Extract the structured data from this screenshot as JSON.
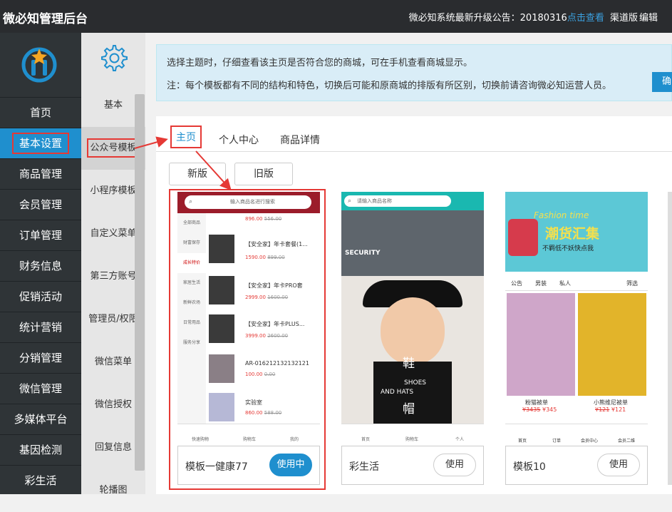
{
  "header": {
    "title": "微必知管理后台",
    "notice_prefix": "微必知系统最新升级公告：20180316",
    "notice_link": "点击查看",
    "channel": "渠道版",
    "edit": "编辑"
  },
  "sidebar": {
    "items": [
      {
        "label": "首页"
      },
      {
        "label": "基本设置"
      },
      {
        "label": "商品管理"
      },
      {
        "label": "会员管理"
      },
      {
        "label": "订单管理"
      },
      {
        "label": "财务信息"
      },
      {
        "label": "促销活动"
      },
      {
        "label": "统计营销"
      },
      {
        "label": "分销管理"
      },
      {
        "label": "微信管理"
      },
      {
        "label": "多媒体平台"
      },
      {
        "label": "基因检测"
      },
      {
        "label": "彩生活"
      }
    ]
  },
  "subnav": {
    "items": [
      {
        "label": "基本"
      },
      {
        "label": "公众号模板"
      },
      {
        "label": "小程序模板"
      },
      {
        "label": "自定义菜单"
      },
      {
        "label": "第三方账号"
      },
      {
        "label": "管理员/权限"
      },
      {
        "label": "微信菜单"
      },
      {
        "label": "微信授权"
      },
      {
        "label": "回复信息"
      },
      {
        "label": "轮播图"
      }
    ]
  },
  "tip": {
    "line1": "选择主题时，仔细查看该主页是否符合您的商城，可在手机查看商城显示。",
    "line2": "注：每个模板都有不同的结构和特色，切换后可能和原商城的排版有所区别，切换前请咨询微必知运营人员。",
    "button": "确"
  },
  "tabs": [
    {
      "label": "主页"
    },
    {
      "label": "个人中心"
    },
    {
      "label": "商品详情"
    }
  ],
  "versions": {
    "new": "新版",
    "old": "旧版"
  },
  "templates": [
    {
      "name": "模板一健康77",
      "button": "使用中",
      "search": "输入商品名进行搜索",
      "categories": [
        "全部商品",
        "财富保存",
        "成长特价",
        "家居生活",
        "新鲜农场",
        "日常用品",
        "服务分享"
      ],
      "products": [
        {
          "title": "",
          "price": "896.00",
          "old": "556.00"
        },
        {
          "title": "【安全家】年卡套餐(1...",
          "price": "1590.00",
          "old": "899.00"
        },
        {
          "title": "【安全家】年卡PRO套",
          "price": "2999.00",
          "old": "1600.00"
        },
        {
          "title": "【安全家】年卡PLUS...",
          "price": "3999.00",
          "old": "2600.00"
        },
        {
          "title": "AR-016212132132121",
          "price": "100.00",
          "old": "0.00"
        },
        {
          "title": "实验室",
          "price": "860.00",
          "old": "588.00"
        }
      ],
      "nav": [
        "快速购物",
        "购物车",
        "我的"
      ]
    },
    {
      "name": "彩生活",
      "button": "使用",
      "search": "请输入商品名称",
      "poster": {
        "security": "SECURITY",
        "xie": "鞋",
        "shoes": "SHOES",
        "and_hats": "AND HATS",
        "mao": "帽"
      },
      "nav": [
        "首页",
        "购物车",
        "个人"
      ]
    },
    {
      "name": "模板10",
      "button": "使用",
      "banner": {
        "en": "Fashion time",
        "title": "潮货汇集",
        "sub": "不羁低不妖快点我"
      },
      "filters": [
        "公告",
        "男装",
        "私人",
        "筛选"
      ],
      "products": [
        {
          "title": "粉猫被单",
          "old": "¥3435",
          "price": "¥345"
        },
        {
          "title": "小熊维尼被单",
          "old": "¥121",
          "price": "¥121"
        }
      ],
      "nav": [
        "首页",
        "订单",
        "会员中心",
        "会员二维"
      ]
    }
  ],
  "colors": {
    "accent": "#1f8fce",
    "highlight": "#e53935",
    "topbar": "#2a2c2f",
    "sidebar": "#2f3437"
  }
}
